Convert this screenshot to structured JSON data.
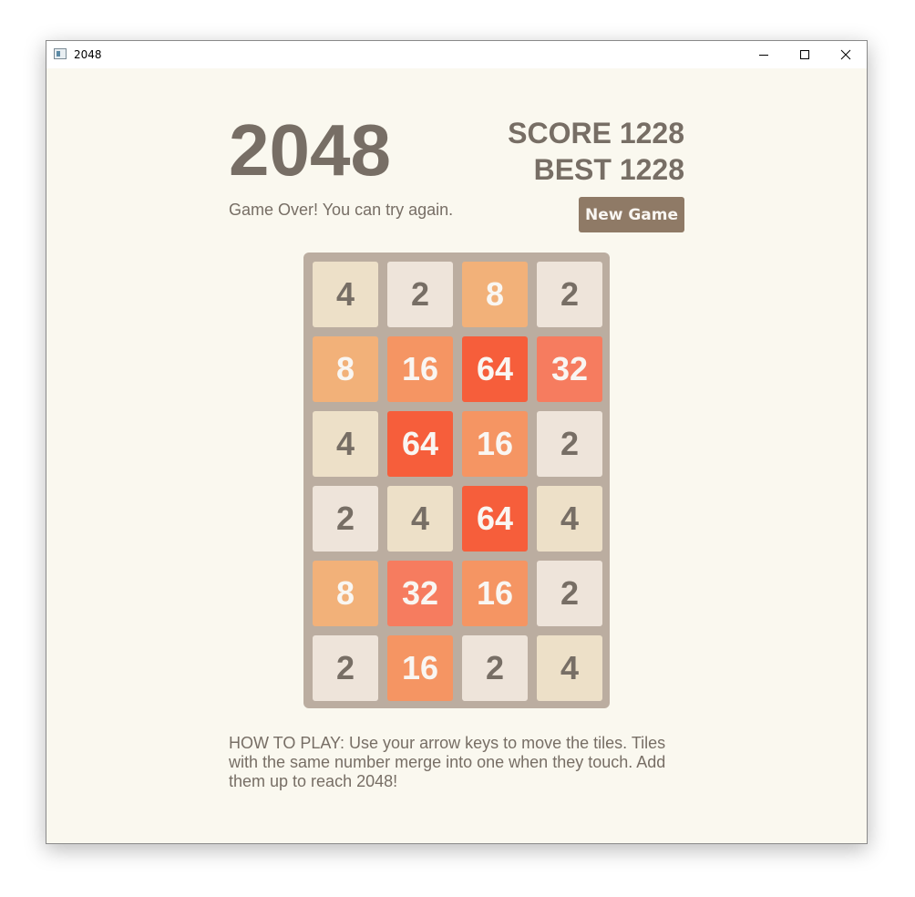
{
  "window": {
    "title": "2048"
  },
  "header": {
    "title": "2048",
    "score_text": "SCORE 1228",
    "best_text": "BEST 1228",
    "status": "Game Over! You can try again.",
    "new_game_label": "New Game"
  },
  "board": {
    "rows": 6,
    "cols": 4,
    "tiles": [
      [
        4,
        2,
        8,
        2
      ],
      [
        8,
        16,
        64,
        32
      ],
      [
        4,
        64,
        16,
        2
      ],
      [
        2,
        4,
        64,
        4
      ],
      [
        8,
        32,
        16,
        2
      ],
      [
        2,
        16,
        2,
        4
      ]
    ]
  },
  "tile_colors": {
    "2": {
      "bg": "#eee4da",
      "fg": "#776e65"
    },
    "4": {
      "bg": "#ede0c8",
      "fg": "#776e65"
    },
    "8": {
      "bg": "#f2b179",
      "fg": "#f9f6f2"
    },
    "16": {
      "bg": "#f59563",
      "fg": "#f9f6f2"
    },
    "32": {
      "bg": "#f67c5f",
      "fg": "#f9f6f2"
    },
    "64": {
      "bg": "#f65e3b",
      "fg": "#f9f6f2"
    }
  },
  "instructions": "HOW TO PLAY: Use your arrow keys to move the tiles. Tiles with the same number merge into one when they touch. Add them up to reach 2048!",
  "colors": {
    "background": "#faf8ef",
    "text": "#776e65",
    "board": "#bbada0",
    "button": "#8f7a66"
  }
}
